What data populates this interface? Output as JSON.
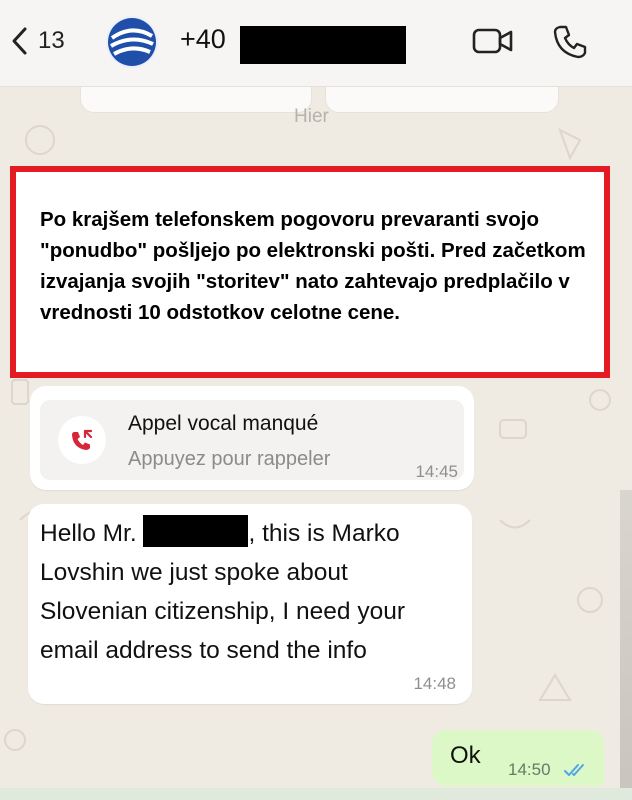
{
  "colors": {
    "chat_background": "#efeae2",
    "notice_border": "#e51b23",
    "outgoing_bubble": "#dcf8c6",
    "read_ticks": "#4fa6e8",
    "missed_call": "#d6263a"
  },
  "header": {
    "back_count": "13",
    "contact_prefix": "+40",
    "icons": [
      "back-chevron-icon",
      "avatar-logo",
      "video-call-icon",
      "phone-icon"
    ]
  },
  "behind_header": {
    "hint": "Hier"
  },
  "notice": {
    "text": "Po krajšem telefonskem pogovoru prevaranti svojo \"ponudbo\" pošljejo po elektronski pošti. Pred začetkom izvajanja svojih \"storitev\" nato zahtevajo predplačilo v vrednosti 10 odstotkov celotne cene."
  },
  "missed_call": {
    "title": "Appel vocal manqué",
    "subtitle": "Appuyez pour rappeler",
    "time": "14:45",
    "icon": "missed-call-icon"
  },
  "message": {
    "part1": "Hello Mr.",
    "part2": ", this is Marko Lovshin we just spoke about Slovenian citizenship, I need your email address to send the info",
    "time": "14:48"
  },
  "outgoing": {
    "text": "Ok",
    "time": "14:50",
    "status_icon": "double-check-icon"
  }
}
